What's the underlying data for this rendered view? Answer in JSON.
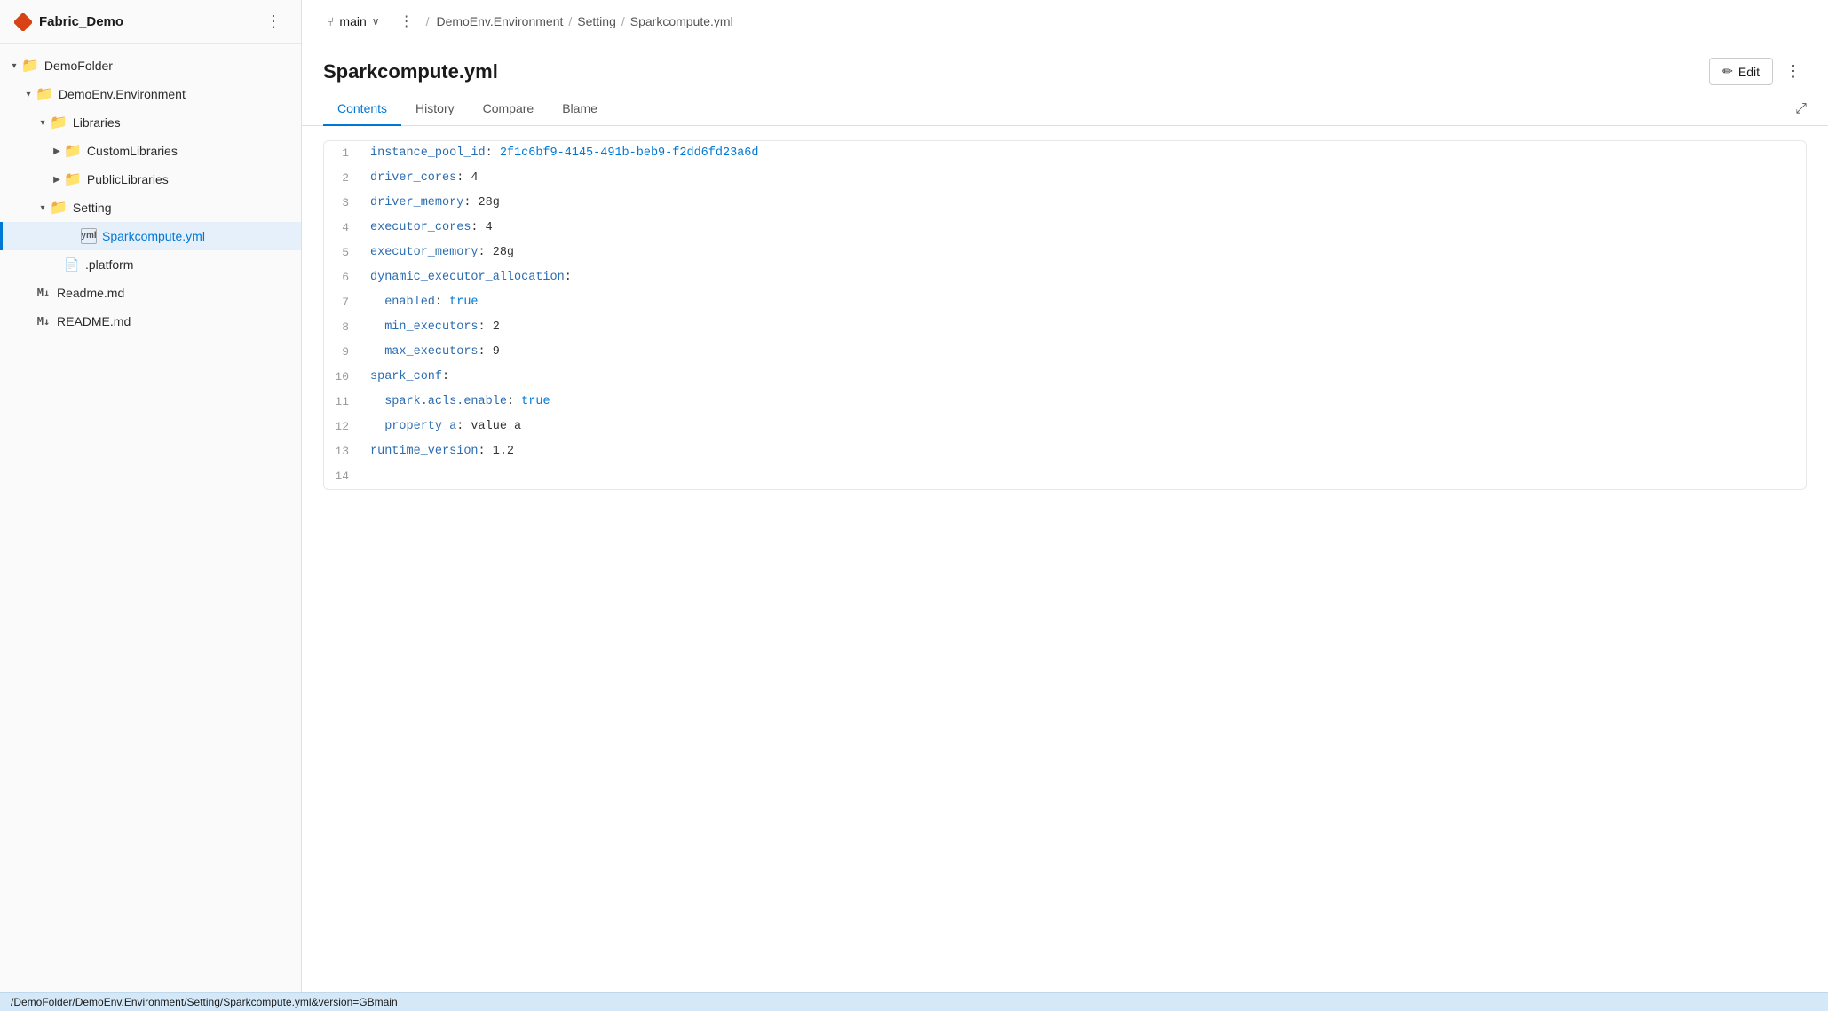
{
  "app": {
    "title": "Fabric_Demo",
    "more_label": "⋮"
  },
  "sidebar": {
    "items": [
      {
        "id": "demofolder",
        "label": "DemoFolder",
        "type": "folder",
        "indent": 0,
        "expanded": true,
        "chevron": "▾"
      },
      {
        "id": "demoenv",
        "label": "DemoEnv.Environment",
        "type": "folder",
        "indent": 1,
        "expanded": true,
        "chevron": "▾"
      },
      {
        "id": "libraries",
        "label": "Libraries",
        "type": "folder",
        "indent": 2,
        "expanded": true,
        "chevron": "▾"
      },
      {
        "id": "customlibs",
        "label": "CustomLibraries",
        "type": "folder",
        "indent": 3,
        "expanded": false,
        "chevron": "▶"
      },
      {
        "id": "publiclibs",
        "label": "PublicLibraries",
        "type": "folder",
        "indent": 3,
        "expanded": false,
        "chevron": "▶"
      },
      {
        "id": "setting",
        "label": "Setting",
        "type": "folder",
        "indent": 2,
        "expanded": true,
        "chevron": "▾"
      },
      {
        "id": "sparkcompute",
        "label": "Sparkcompute.yml",
        "type": "yml",
        "indent": 4,
        "selected": true
      },
      {
        "id": "platform",
        "label": ".platform",
        "type": "file",
        "indent": 3,
        "selected": false
      },
      {
        "id": "readme-md",
        "label": "Readme.md",
        "type": "md",
        "indent": 1,
        "selected": false
      },
      {
        "id": "readme-MD",
        "label": "README.md",
        "type": "md",
        "indent": 1,
        "selected": false
      }
    ]
  },
  "topbar": {
    "branch_icon": "⑂",
    "branch_name": "main",
    "more_label": "⋮",
    "breadcrumb": [
      "DemoEnv.Environment",
      "Setting",
      "Sparkcompute.yml"
    ]
  },
  "file": {
    "title": "Sparkcompute.yml",
    "edit_label": "Edit",
    "more_label": "⋮",
    "tabs": [
      "Contents",
      "History",
      "Compare",
      "Blame"
    ],
    "active_tab": "Contents"
  },
  "code": {
    "lines": [
      {
        "num": 1,
        "parts": [
          {
            "t": "key",
            "v": "instance_pool_id"
          },
          {
            "t": "colon",
            "v": ": "
          },
          {
            "t": "val-str",
            "v": "2f1c6bf9-4145-491b-beb9-f2dd6fd23a6d"
          }
        ]
      },
      {
        "num": 2,
        "parts": [
          {
            "t": "key",
            "v": "driver_cores"
          },
          {
            "t": "colon",
            "v": ": "
          },
          {
            "t": "num",
            "v": "4"
          }
        ]
      },
      {
        "num": 3,
        "parts": [
          {
            "t": "key",
            "v": "driver_memory"
          },
          {
            "t": "colon",
            "v": ": "
          },
          {
            "t": "num",
            "v": "28g"
          }
        ]
      },
      {
        "num": 4,
        "parts": [
          {
            "t": "key",
            "v": "executor_cores"
          },
          {
            "t": "colon",
            "v": ": "
          },
          {
            "t": "num",
            "v": "4"
          }
        ]
      },
      {
        "num": 5,
        "parts": [
          {
            "t": "key",
            "v": "executor_memory"
          },
          {
            "t": "colon",
            "v": ": "
          },
          {
            "t": "num",
            "v": "28g"
          }
        ]
      },
      {
        "num": 6,
        "parts": [
          {
            "t": "key",
            "v": "dynamic_executor_allocation"
          },
          {
            "t": "colon",
            "v": ":"
          }
        ]
      },
      {
        "num": 7,
        "parts": [
          {
            "t": "indent",
            "v": "  "
          },
          {
            "t": "key",
            "v": "enabled"
          },
          {
            "t": "colon",
            "v": ": "
          },
          {
            "t": "bool",
            "v": "true"
          }
        ]
      },
      {
        "num": 8,
        "parts": [
          {
            "t": "indent",
            "v": "  "
          },
          {
            "t": "key",
            "v": "min_executors"
          },
          {
            "t": "colon",
            "v": ": "
          },
          {
            "t": "num",
            "v": "2"
          }
        ]
      },
      {
        "num": 9,
        "parts": [
          {
            "t": "indent",
            "v": "  "
          },
          {
            "t": "key",
            "v": "max_executors"
          },
          {
            "t": "colon",
            "v": ": "
          },
          {
            "t": "num",
            "v": "9"
          }
        ]
      },
      {
        "num": 10,
        "parts": [
          {
            "t": "key",
            "v": "spark_conf"
          },
          {
            "t": "colon",
            "v": ":"
          }
        ]
      },
      {
        "num": 11,
        "parts": [
          {
            "t": "indent",
            "v": "  "
          },
          {
            "t": "key",
            "v": "spark.acls.enable"
          },
          {
            "t": "colon",
            "v": ": "
          },
          {
            "t": "bool",
            "v": "true"
          }
        ]
      },
      {
        "num": 12,
        "parts": [
          {
            "t": "indent",
            "v": "  "
          },
          {
            "t": "key",
            "v": "property_a"
          },
          {
            "t": "colon",
            "v": ": "
          },
          {
            "t": "num",
            "v": "value_a"
          }
        ]
      },
      {
        "num": 13,
        "parts": [
          {
            "t": "key",
            "v": "runtime_version"
          },
          {
            "t": "colon",
            "v": ": "
          },
          {
            "t": "num",
            "v": "1.2"
          }
        ]
      },
      {
        "num": 14,
        "parts": []
      }
    ]
  },
  "statusbar": {
    "path": "/DemoFolder/DemoEnv.Environment/Setting/Sparkcompute.yml&version=GBmain"
  }
}
